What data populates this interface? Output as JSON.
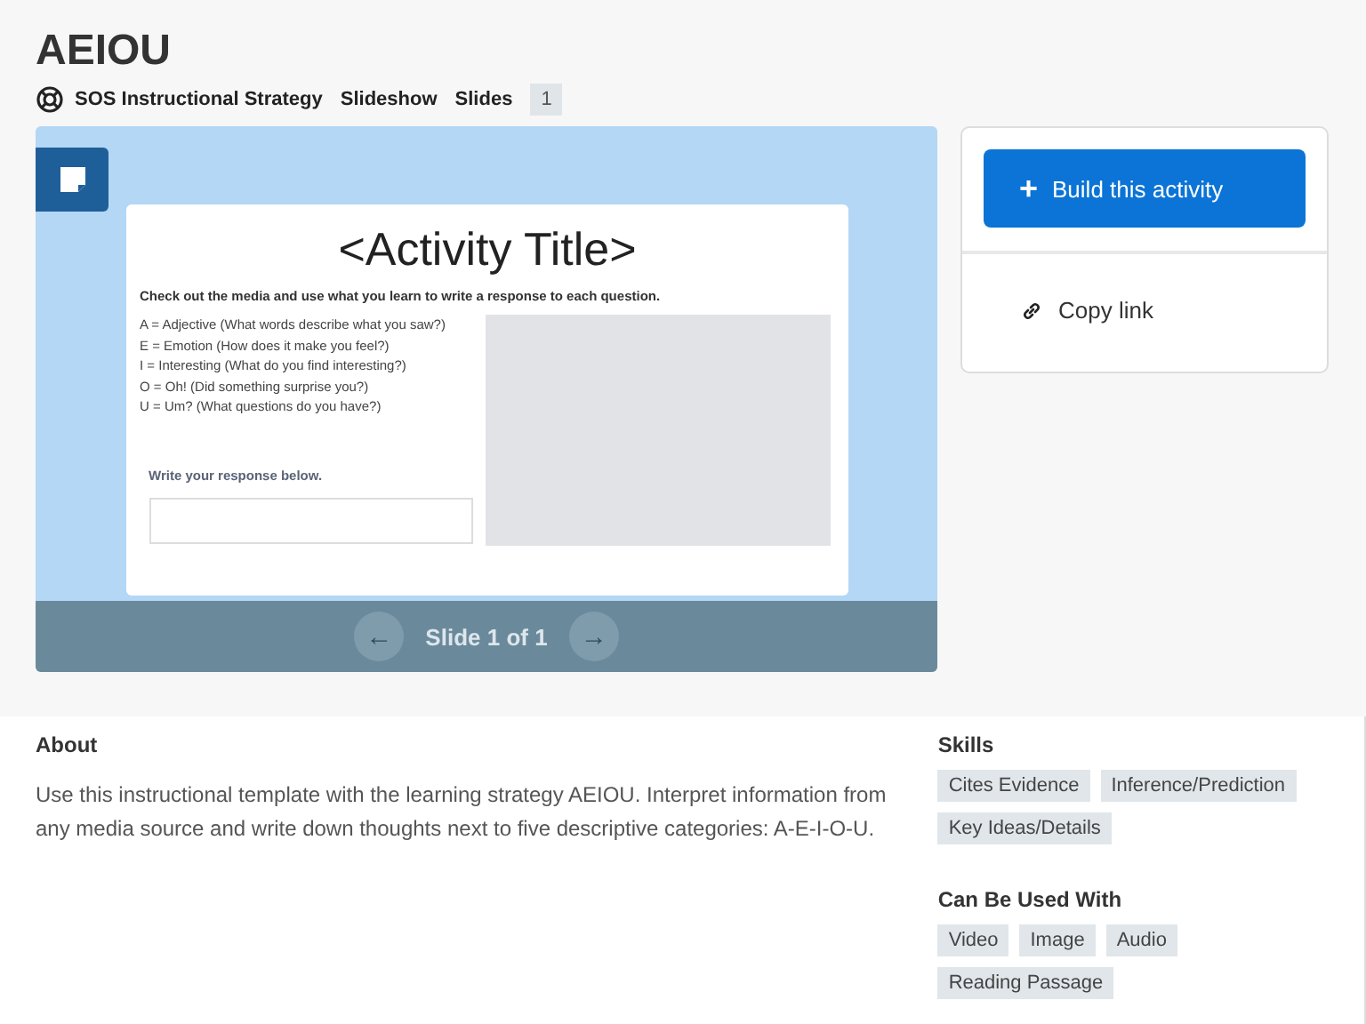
{
  "title": "AEIOU",
  "meta": {
    "strategy": "SOS Instructional Strategy",
    "type": "Slideshow",
    "slides_label": "Slides",
    "slides_count": "1"
  },
  "slide": {
    "title": "<Activity Title>",
    "instructions": "Check out the media and use what you learn to write a response to each question.",
    "prompts": [
      "A = Adjective (What words describe what you saw?)",
      "E = Emotion (How does it make you feel?)",
      "I = Interesting (What do you find interesting?)",
      "O = Oh! (Did something surprise you?)",
      "U = Um? (What questions do you have?)"
    ],
    "response_label": "Write your response below."
  },
  "pager": {
    "prev": "←",
    "label": "Slide 1 of 1",
    "next": "→"
  },
  "actions": {
    "build": "Build this activity",
    "build_icon": "+",
    "copy": "Copy link"
  },
  "about": {
    "heading": "About",
    "text": "Use this instructional template with the learning strategy AEIOU. Interpret information from any media source and write down thoughts next to five descriptive categories: A-E-I-O-U."
  },
  "skills": {
    "heading": "Skills",
    "tags": [
      "Cites Evidence",
      "Inference/Prediction",
      "Key Ideas/Details"
    ]
  },
  "used_with": {
    "heading": "Can Be Used With",
    "tags": [
      "Video",
      "Image",
      "Audio",
      "Reading Passage"
    ]
  }
}
